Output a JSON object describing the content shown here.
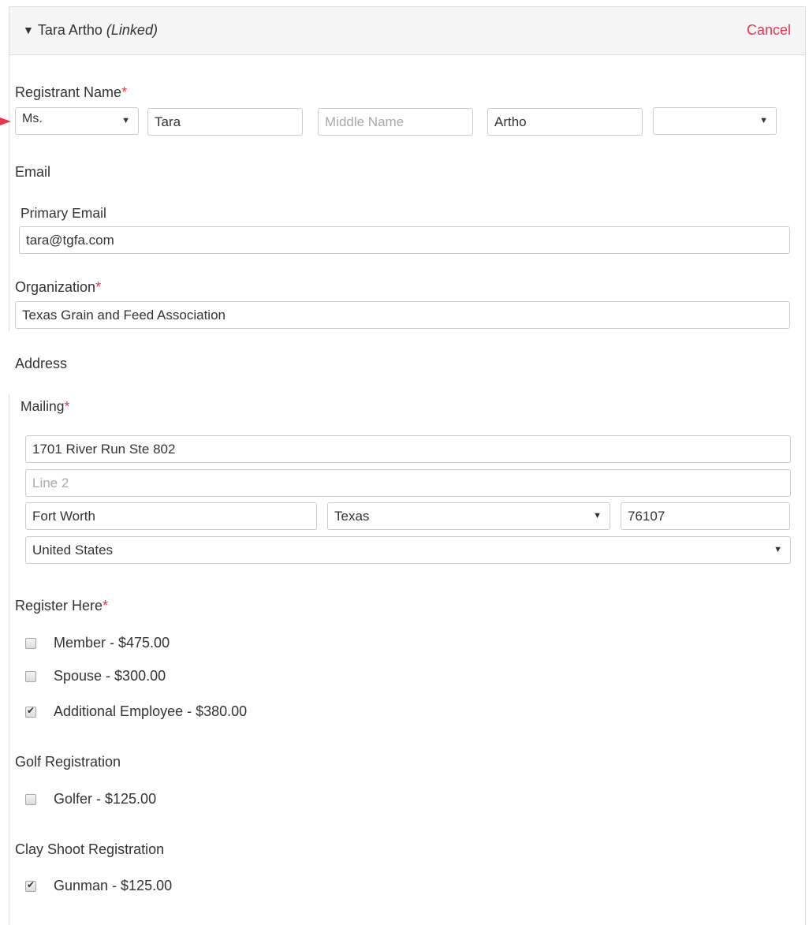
{
  "panel": {
    "name": "Tara Artho",
    "linked": "(Linked)",
    "cancel": "Cancel"
  },
  "registrant": {
    "label": "Registrant Name",
    "prefix": "Ms.",
    "first": "Tara",
    "middle_placeholder": "Middle Name",
    "last": "Artho",
    "suffix": ""
  },
  "email": {
    "section": "Email",
    "primary_label": "Primary Email",
    "primary_value": "tara@tgfa.com"
  },
  "organization": {
    "label": "Organization",
    "value": "Texas Grain and Feed Association"
  },
  "address": {
    "section": "Address",
    "mailing_label": "Mailing",
    "line1": "1701 River Run Ste 802",
    "line2_placeholder": "Line 2",
    "city": "Fort Worth",
    "state": "Texas",
    "zip": "76107",
    "country": "United States"
  },
  "register_here": {
    "label": "Register Here",
    "options": [
      {
        "label": "Member - $475.00",
        "checked": false
      },
      {
        "label": "Spouse - $300.00",
        "checked": false
      },
      {
        "label": "Additional Employee - $380.00",
        "checked": true
      }
    ]
  },
  "golf": {
    "label": "Golf Registration",
    "options": [
      {
        "label": "Golfer - $125.00",
        "checked": false
      }
    ]
  },
  "clay": {
    "label": "Clay Shoot Registration",
    "options": [
      {
        "label": "Gunman - $125.00",
        "checked": true
      }
    ]
  },
  "colors": {
    "required": "#e8344e",
    "border": "#cccccc",
    "header_bg": "#f5f5f5"
  }
}
